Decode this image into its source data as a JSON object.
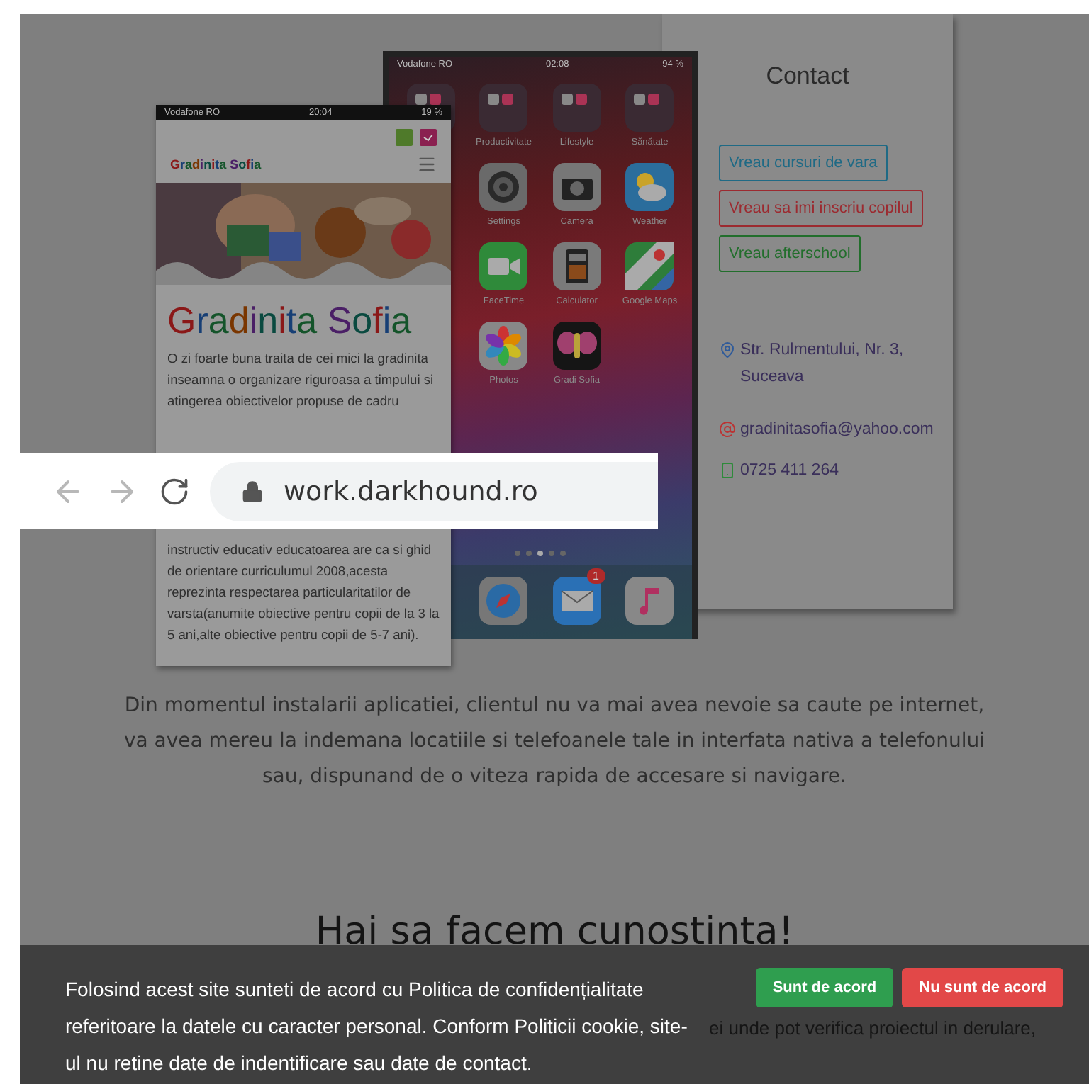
{
  "address_bar": {
    "url": "work.darkhound.ro"
  },
  "left_phone": {
    "carrier": "Vodafone RO",
    "time": "20:04",
    "battery": "19 %",
    "logo": "Gradinita Sofia",
    "title": "Gradinita Sofia",
    "body_top": "O zi foarte buna traita de cei mici la gradinita inseamna o organizare riguroasa a timpului si atingerea obiectivelor propuse de cadru",
    "body_bottom": "instructiv educativ educatoarea are ca si ghid de orientare curriculumul 2008,acesta reprezinta respectarea particularitatilor de varsta(anumite obiective pentru copii de la 3 la 5 ani,alte obiective pentru copii de 5-7 ani)."
  },
  "middle_phone": {
    "carrier": "Vodafone RO",
    "time": "02:08",
    "battery": "94 %",
    "apps": [
      {
        "kind": "folder"
      },
      {
        "kind": "folder",
        "label": "Productivitate"
      },
      {
        "kind": "folder",
        "label": "Lifestyle"
      },
      {
        "kind": "folder",
        "label": "Sănătate"
      },
      {
        "kind": "hidden"
      },
      {
        "kind": "gear",
        "label": "Settings"
      },
      {
        "kind": "camera",
        "label": "Camera"
      },
      {
        "kind": "weather",
        "label": "Weather"
      },
      {
        "kind": "hidden"
      },
      {
        "kind": "video",
        "label": "FaceTime"
      },
      {
        "kind": "calculator",
        "label": "Calculator"
      },
      {
        "kind": "map",
        "label": "Google Maps"
      },
      {
        "kind": "hidden"
      },
      {
        "kind": "flower",
        "label": "Photos"
      },
      {
        "kind": "butterfly",
        "label": "Gradi Sofia"
      }
    ],
    "dock": [
      {
        "kind": "compass"
      },
      {
        "kind": "mail",
        "badge": "1"
      },
      {
        "kind": "music"
      }
    ]
  },
  "right_phone": {
    "title": "Contact",
    "buttons": [
      {
        "label": "Vreau cursuri de vara",
        "color": "#1f6a85"
      },
      {
        "label": "Vreau sa imi inscriu copilul",
        "color": "#9c2a30"
      },
      {
        "label": "Vreau afterschool",
        "color": "#226e2c"
      }
    ],
    "address": "Str. Rulmentului, Nr. 3, Suceava",
    "email": "gradinitasofia@yahoo.com",
    "phone": "0725 411 264"
  },
  "intro": "Din momentul instalarii aplicatiei, clientul nu va mai avea nevoie sa caute pe internet, va avea mereu la indemana locatiile si telefoanele tale in interfata nativa a telefonului sau, dispunand de o viteza rapida de accesare si navigare.",
  "heading": "Hai sa facem cunostinta!",
  "partial_line": "ei unde pot verifica proiectul in derulare,",
  "cookie_bar": {
    "text": "Folosind acest site sunteti de acord cu Politica de confidențialitate referitoare la datele cu caracter personal. Conform Politicii cookie, site-ul nu retine date de indentificare sau date de contact.",
    "buttons": [
      {
        "label": "Sunt de acord",
        "kind": "accept"
      },
      {
        "label": "Nu sunt de acord",
        "kind": "decline"
      }
    ]
  }
}
